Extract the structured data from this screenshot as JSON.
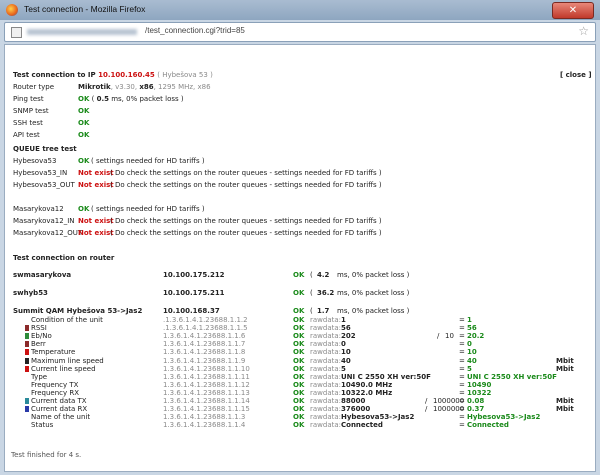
{
  "window": {
    "title": "Test connection - Mozilla Firefox",
    "close_glyph": "✕"
  },
  "urlbar": {
    "url_text": "/test_connection.cgi?trid=85"
  },
  "header": {
    "prefix": "Test connection to IP",
    "ip": "10.100.160.45",
    "location": "( Hybešova 53 )",
    "close_link": "[ close ]"
  },
  "info": {
    "router_type_label": "Router type",
    "router_type_name": "Mikrotik",
    "router_type_ver": ", v3.30, ",
    "router_type_arch": "x86",
    "router_type_rest": ", 1295 MHz, x86",
    "ping_label": "Ping test",
    "ping_ok": "OK",
    "ping_paren_open": "(",
    "ping_ms": "0.5",
    "ping_rest": "ms, 0% packet loss )",
    "snmp_label": "SNMP test",
    "snmp_ok": "OK",
    "ssh_label": "SSH test",
    "ssh_ok": "OK",
    "api_label": "API test",
    "api_ok": "OK"
  },
  "queue": {
    "heading": "QUEUE tree test",
    "rows": [
      {
        "name": "Hybesova53",
        "status": "OK",
        "note": "( settings needed for HD tariffs )"
      },
      {
        "name": "Hybesova53_IN",
        "status": "Not exist",
        "note": "( Do check the settings on the router queues - settings needed for FD tariffs )"
      },
      {
        "name": "Hybesova53_OUT",
        "status": "Not exist",
        "note": "( Do check the settings on the router queues - settings needed for FD tariffs )"
      },
      {
        "name": "Masarykova12",
        "status": "OK",
        "note": "( settings needed for HD tariffs )"
      },
      {
        "name": "Masarykova12_IN",
        "status": "Not exist",
        "note": "( Do check the settings on the router queues - settings needed for FD tariffs )"
      },
      {
        "name": "Masarykova12_OUT",
        "status": "Not exist",
        "note": "( Do check the settings on the router queues - settings needed for FD tariffs )"
      }
    ]
  },
  "router_test": {
    "heading": "Test connection on router",
    "hosts": [
      {
        "name": "swmasarykova",
        "ip": "10.100.175.212",
        "status": "OK",
        "ms": "4.2",
        "rest": "ms, 0% packet loss )"
      },
      {
        "name": "swhyb53",
        "ip": "10.100.175.211",
        "status": "OK",
        "ms": "36.2",
        "rest": "ms, 0% packet loss )"
      },
      {
        "name": "Summit QAM Hybešova 53->Jas2",
        "ip": "10.100.168.37",
        "status": "OK",
        "ms": "1.7",
        "rest": "ms, 0% packet loss )"
      }
    ],
    "paren_open": "(",
    "params": [
      {
        "name": "Condition of the unit",
        "oid": ".1.3.6.1.4.1.23688.1.1.2",
        "status": "OK",
        "raw_label": "rawdata:",
        "raw": "1",
        "div": "",
        "den": "",
        "eq": "=",
        "val": "1",
        "unit": "",
        "color": ""
      },
      {
        "name": "RSSI",
        "oid": ".1.3.6.1.4.1.23688.1.1.5",
        "status": "OK",
        "raw_label": "rawdata:",
        "raw": "56",
        "div": "",
        "den": "",
        "eq": "=",
        "val": "56",
        "unit": "",
        "color": "#8b2a2a"
      },
      {
        "name": "Eb/No",
        "oid": "1.3.6.1.4.1.23688.1.1.6",
        "status": "OK",
        "raw_label": "rawdata:",
        "raw": "202",
        "div": "/",
        "den": "10",
        "eq": "=",
        "val": "20.2",
        "unit": "",
        "color": "#2e8b3a"
      },
      {
        "name": "Berr",
        "oid": "1.3.6.1.4.1.23688.1.1.7",
        "status": "OK",
        "raw_label": "rawdata:",
        "raw": "0",
        "div": "",
        "den": "",
        "eq": "=",
        "val": "0",
        "unit": "",
        "color": "#8b2a2a"
      },
      {
        "name": "Temperature",
        "oid": "1.3.6.1.4.1.23688.1.1.8",
        "status": "OK",
        "raw_label": "rawdata:",
        "raw": "10",
        "div": "",
        "den": "",
        "eq": "=",
        "val": "10",
        "unit": "",
        "color": "#cc1111"
      },
      {
        "name": "Maximum line speed",
        "oid": "1.3.6.1.4.1.23688.1.1.9",
        "status": "OK",
        "raw_label": "rawdata:",
        "raw": "40",
        "div": "",
        "den": "",
        "eq": "=",
        "val": "40",
        "unit": "Mbit",
        "color": "#222222"
      },
      {
        "name": "Current line speed",
        "oid": "1.3.6.1.4.1.23688.1.1.10",
        "status": "OK",
        "raw_label": "rawdata:",
        "raw": "5",
        "div": "",
        "den": "",
        "eq": "=",
        "val": "5",
        "unit": "Mbit",
        "color": "#cc1111"
      },
      {
        "name": "Type",
        "oid": "1.3.6.1.4.1.23688.1.1.11",
        "status": "OK",
        "raw_label": "rawdata:",
        "raw": "UNI C 2550 XH ver:50F",
        "div": "",
        "den": "",
        "eq": "=",
        "val": "UNI C 2550 XH ver:50F",
        "unit": "",
        "color": ""
      },
      {
        "name": "Frequency TX",
        "oid": "1.3.6.1.4.1.23688.1.1.12",
        "status": "OK",
        "raw_label": "rawdata:",
        "raw": "10490.0 MHz",
        "div": "",
        "den": "",
        "eq": "=",
        "val": "10490",
        "unit": "",
        "color": ""
      },
      {
        "name": "Frequency RX",
        "oid": "1.3.6.1.4.1.23688.1.1.13",
        "status": "OK",
        "raw_label": "rawdata:",
        "raw": "10322.0 MHz",
        "div": "",
        "den": "",
        "eq": "=",
        "val": "10322",
        "unit": "",
        "color": ""
      },
      {
        "name": "Current data TX",
        "oid": "1.3.6.1.4.1.23688.1.1.14",
        "status": "OK",
        "raw_label": "rawdata:",
        "raw": "88000",
        "div": "/",
        "den": "1000000",
        "eq": "=",
        "val": "0.08",
        "unit": "Mbit",
        "color": "#2a8a9a"
      },
      {
        "name": "Current data RX",
        "oid": "1.3.6.1.4.1.23688.1.1.15",
        "status": "OK",
        "raw_label": "rawdata:",
        "raw": "376000",
        "div": "/",
        "den": "1000000",
        "eq": "=",
        "val": "0.37",
        "unit": "Mbit",
        "color": "#2a3aa8"
      },
      {
        "name": "Name of the unit",
        "oid": "1.3.6.1.4.1.23688.1.1.3",
        "status": "OK",
        "raw_label": "rawdata:",
        "raw": "Hybesova53->Jas2",
        "div": "",
        "den": "",
        "eq": "=",
        "val": "Hybesova53->Jas2",
        "unit": "",
        "color": ""
      },
      {
        "name": "Status",
        "oid": "1.3.6.1.4.1.23688.1.1.4",
        "status": "OK",
        "raw_label": "rawdata:",
        "raw": "Connected",
        "div": "",
        "den": "",
        "eq": "=",
        "val": "Connected",
        "unit": "",
        "color": ""
      }
    ]
  },
  "footer": {
    "text": "Test finished for 4 s."
  }
}
